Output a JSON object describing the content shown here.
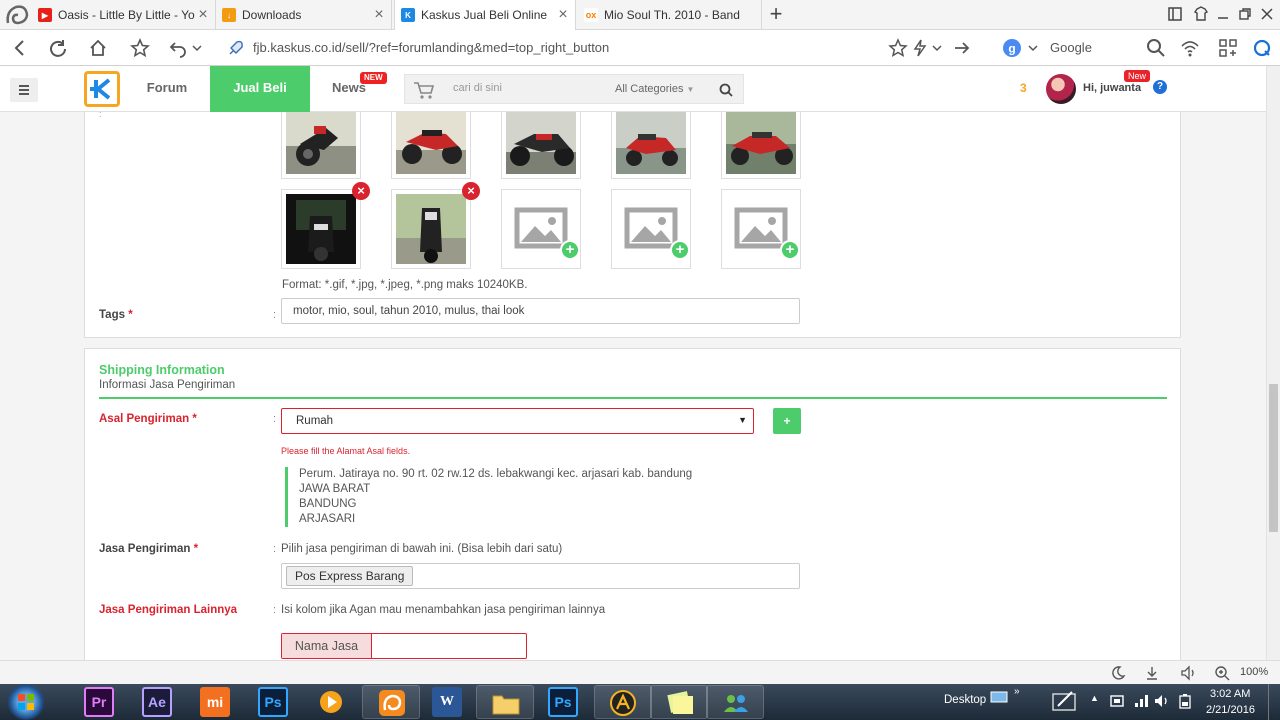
{
  "tabs": [
    {
      "label": "Oasis - Little By Little - Yo",
      "favicon": "youtube-icon",
      "color": "#e62117"
    },
    {
      "label": "Downloads",
      "favicon": "download-icon",
      "color": "#f39c12"
    },
    {
      "label": "Kaskus Jual Beli Online",
      "favicon": "kaskus-icon",
      "color": "#1e88e5"
    },
    {
      "label": "Mio Soul Th. 2010 - Band",
      "favicon": "olx-icon",
      "color": "#ff7a00"
    }
  ],
  "address": {
    "url": "fjb.kaskus.co.id/sell/?ref=forumlanding&med=top_right_button",
    "search_engine": "Google"
  },
  "site_header": {
    "nav": [
      "Forum",
      "Jual Beli",
      "News"
    ],
    "news_badge": "NEW",
    "search_placeholder": "cari di sini",
    "category": "All Categories",
    "notif_count": "3",
    "greeting": "Hi, juwanta",
    "user_badge": "New",
    "help": "?"
  },
  "images": {
    "format_note": "Format: *.gif, *.jpg, *.jpeg, *.png maks 10240KB."
  },
  "tags": {
    "label": "Tags",
    "required": "*",
    "value": "motor, mio, soul, tahun 2010, mulus, thai look"
  },
  "shipping": {
    "title": "Shipping Information",
    "subtitle": "Informasi Jasa Pengiriman",
    "asal_label": "Asal Pengiriman",
    "asal_value": "Rumah",
    "add_button": "+",
    "error": "Please fill the Alamat Asal fields.",
    "address_lines": [
      "Perum. Jatiraya no. 90 rt. 02 rw.12 ds. lebakwangi kec. arjasari kab. bandung",
      "JAWA BARAT",
      "BANDUNG",
      "ARJASARI"
    ],
    "jasa_label": "Jasa Pengiriman",
    "jasa_hint": "Pilih jasa pengiriman di bawah ini. (Bisa lebih dari satu)",
    "jasa_selected": "Pos Express Barang",
    "lainnya_label": "Jasa Pengiriman Lainnya",
    "lainnya_hint": "Isi kolom jika Agan mau menambahkan jasa pengiriman lainnya",
    "nama_jasa": "Nama Jasa"
  },
  "statusbar": {
    "zoom": "100%"
  },
  "taskbar": {
    "apps": [
      "Pr",
      "Ae",
      "mi",
      "Ps",
      "",
      "",
      "W",
      "",
      "Ps",
      "",
      "",
      ""
    ],
    "desktop": "Desktop",
    "time": "3:02 AM",
    "date": "2/21/2016"
  }
}
